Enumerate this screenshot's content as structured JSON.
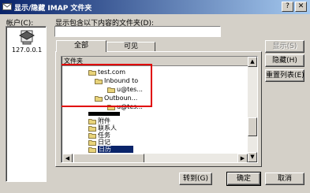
{
  "window": {
    "title": "显示/隐藏 IMAP 文件夹",
    "help_glyph": "?",
    "close_glyph": "✕"
  },
  "accounts": {
    "label": "帐户(C):",
    "items": [
      {
        "name": "127.0.0.1"
      }
    ]
  },
  "filter": {
    "label": "显示包含以下内容的文件夹(D):",
    "value": ""
  },
  "tabs": [
    {
      "label": "全部"
    },
    {
      "label": "可见"
    }
  ],
  "list": {
    "column_header": "文件夹",
    "rows": [
      {
        "text": "test.com",
        "indent": 1,
        "selected": false
      },
      {
        "text": "Inbound to",
        "indent": 2,
        "selected": false
      },
      {
        "text": "u@tes...",
        "indent": 3,
        "selected": false
      },
      {
        "text": "Outboun...",
        "indent": 2,
        "selected": false
      },
      {
        "text": "u@tes...",
        "indent": 3,
        "selected": false
      },
      {
        "text": "",
        "indent": 1,
        "selected": false,
        "redacted": true
      },
      {
        "text": "附件",
        "indent": 1,
        "selected": false
      },
      {
        "text": "联系人",
        "indent": 1,
        "selected": false
      },
      {
        "text": "任务",
        "indent": 1,
        "selected": false
      },
      {
        "text": "日记",
        "indent": 1,
        "selected": false
      },
      {
        "text": "日历",
        "indent": 1,
        "selected": true
      }
    ]
  },
  "side_buttons": {
    "show": "显示(S)",
    "hide": "隐藏(H)",
    "reset": "重置列表(E)"
  },
  "footer_buttons": {
    "goto": "转到(G)",
    "ok": "确定",
    "cancel": "取消"
  },
  "colors": {
    "title_start": "#0a246a",
    "title_end": "#a6caf0",
    "selection": "#0a246a",
    "highlight_box": "#e00000",
    "folder_fill": "#e8d37a"
  }
}
